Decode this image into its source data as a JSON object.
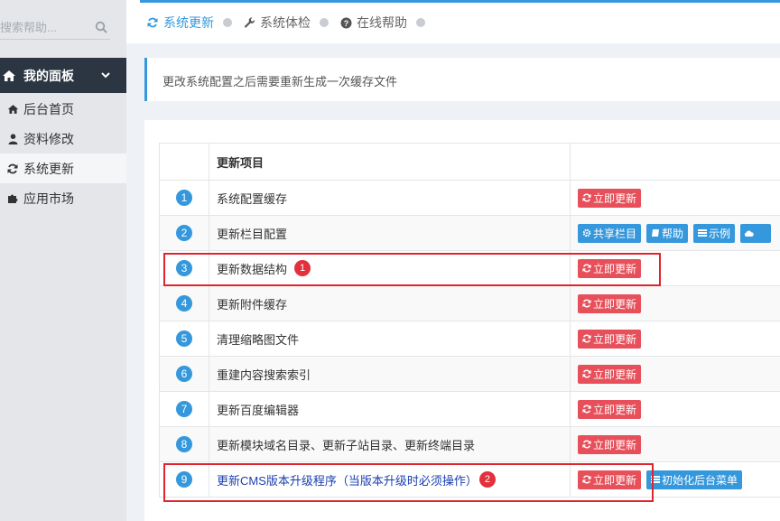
{
  "sidebar": {
    "search_placeholder": "搜索帮助...",
    "menu_title": "我的面板",
    "items": [
      {
        "label": "后台首页",
        "icon": "home-icon"
      },
      {
        "label": "资料修改",
        "icon": "user-icon"
      },
      {
        "label": "系统更新",
        "icon": "refresh-icon",
        "active": true
      },
      {
        "label": "应用市场",
        "icon": "puzzle-icon"
      }
    ]
  },
  "tabs": [
    {
      "label": "系统更新",
      "icon": "refresh-icon",
      "active": true
    },
    {
      "label": "系统体检",
      "icon": "wrench-icon"
    },
    {
      "label": "在线帮助",
      "icon": "question-icon"
    }
  ],
  "notice": "更改系统配置之后需要重新生成一次缓存文件",
  "table": {
    "header": "更新项目",
    "rows": [
      {
        "num": "1",
        "name": "系统配置缓存"
      },
      {
        "num": "2",
        "name": "更新栏目配置"
      },
      {
        "num": "3",
        "name": "更新数据结构",
        "badge": "1"
      },
      {
        "num": "4",
        "name": "更新附件缓存"
      },
      {
        "num": "5",
        "name": "清理缩略图文件"
      },
      {
        "num": "6",
        "name": "重建内容搜索索引"
      },
      {
        "num": "7",
        "name": "更新百度编辑器"
      },
      {
        "num": "8",
        "name": "更新模块域名目录、更新子站目录、更新终端目录"
      },
      {
        "num": "9",
        "name": "更新CMS版本升级程序（当版本升级时必须操作）",
        "badge": "2"
      }
    ],
    "update_label": "立即更新",
    "share_label": "共享栏目",
    "help_label": "帮助",
    "example_label": "示例",
    "more_label": " ",
    "init_menu_label": "初始化后台菜单"
  },
  "colors": {
    "accent": "#3598dc",
    "danger": "#e7505a",
    "highlight": "#e0242e",
    "sidebar_dark": "#2c3542"
  }
}
